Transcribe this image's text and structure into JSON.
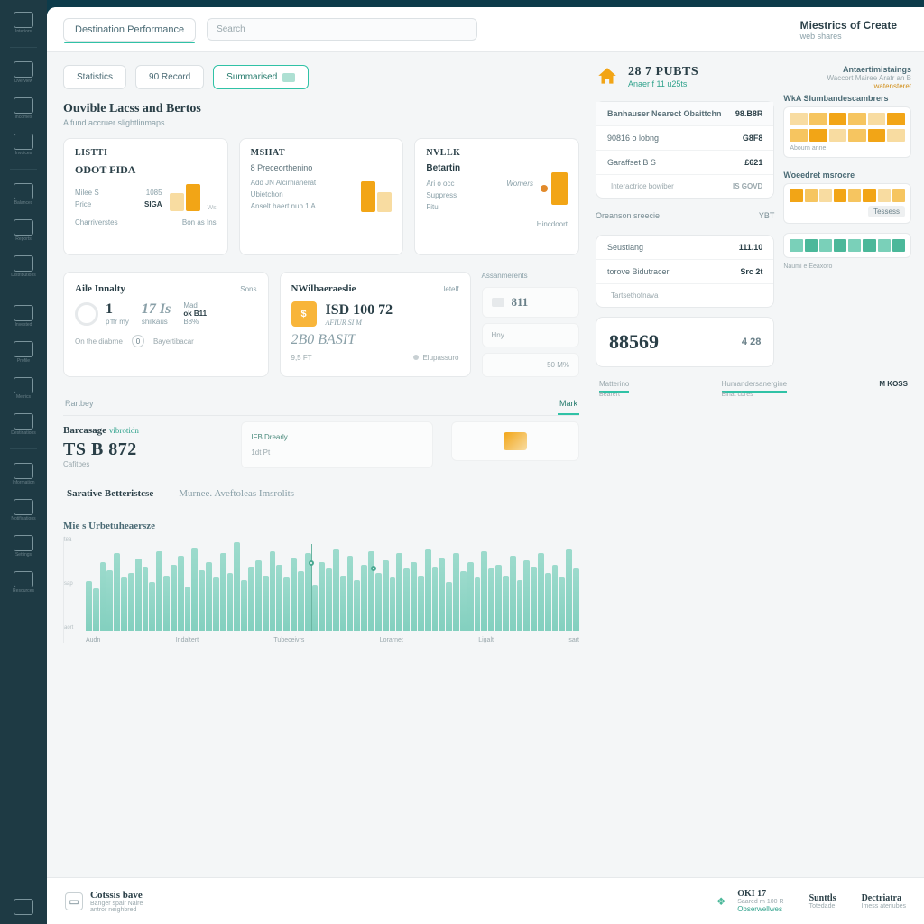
{
  "sidebar": {
    "items": [
      {
        "label": "Interiors"
      },
      {
        "label": "Overview"
      },
      {
        "label": "Incomes"
      },
      {
        "label": "Invoices"
      },
      {
        "label": "Balances"
      },
      {
        "label": "Reports"
      },
      {
        "label": "Distributions"
      },
      {
        "label": "Invested"
      },
      {
        "label": "Profile"
      },
      {
        "label": "Metrics"
      },
      {
        "label": "Destinations"
      },
      {
        "label": "Information"
      },
      {
        "label": "Notifications"
      },
      {
        "label": "Settings"
      },
      {
        "label": "Resources"
      }
    ]
  },
  "topbar": {
    "breadcrumb": "Destination Performance",
    "search_placeholder": "Search",
    "title": "Miestrics of Create",
    "subtitle": "web shares"
  },
  "pills": {
    "a": "Statistics",
    "b": "90 Record",
    "c": "Summarised"
  },
  "section1": {
    "title": "Ouvible Lacss and Bertos",
    "subtitle": "A fund accruer slightlinmaps"
  },
  "cards": [
    {
      "label": "LISTTI",
      "big": "ODOT FIDA",
      "lines": [
        [
          "Milee S",
          "1085"
        ],
        [
          "Price",
          "SIGA"
        ]
      ],
      "foot_l": "Charriverstes",
      "foot_r": "Bon  as Ins",
      "side": "Ws"
    },
    {
      "label": "MSHAT",
      "big": "8 Preceorthenino",
      "lines": [
        [
          "Add JN Alcirhianerat",
          ""
        ],
        [
          "Ubietchon",
          ""
        ],
        [
          "Anselt haert nup 1 A",
          ""
        ]
      ],
      "foot_l": "",
      "foot_r": ""
    },
    {
      "label": "NVLLK",
      "big": "Betartin",
      "lines": [
        [
          "Ari o occ",
          "Womers"
        ],
        [
          "Suppress",
          ""
        ],
        [
          "Fitu",
          ""
        ]
      ],
      "foot_l": "",
      "foot_r": "Hincdoort",
      "badge": ""
    }
  ],
  "wide": {
    "left": {
      "title": "Aile Innalty",
      "side": "Sons",
      "kpi1_val": "1",
      "kpi1_sub1": "p'ffr",
      "kpi1_sub2": "my",
      "kpi2_val": "17 Is",
      "kpi2_sub": "shilkaus",
      "kpi3_lbl": "Mad",
      "kpi3_val": "ok B11",
      "foot_l": "On the diabrne",
      "foot_badge": "0",
      "foot_r": "Bayertibacar",
      "side2": "B8%"
    },
    "mid": {
      "title": "NWilhaeraeslie",
      "side": "letelf",
      "currency_line": "ISD 100 72",
      "sub1": "AFIUR  SI M",
      "big2": "2B0 BASIT",
      "foot1": "9,5 FT",
      "foot2": "Elupassuro"
    },
    "right": {
      "title": "Assanmerents",
      "val": "811",
      "rows": [
        [
          "Hny",
          ""
        ],
        [
          "",
          "50 M%"
        ]
      ]
    }
  },
  "tabs": {
    "items": [
      "Rartbey",
      "Mark"
    ],
    "active": 1
  },
  "sublinks": {
    "a": "IFB Drearly",
    "b": "1dt Pt"
  },
  "balance": {
    "label": "Barcasage",
    "tag": "vibrotidn",
    "value": "TS B 872",
    "hint": "Cafitbes"
  },
  "tab_buttons": {
    "a": "Sarative Betteristcse",
    "b": "Murnee. Aveftoleas Imsrolits"
  },
  "chart": {
    "title": "Mie s Urbetuheaersze",
    "y": [
      "tea",
      "sap",
      "aort"
    ],
    "x": [
      "Audn",
      "Indaltert",
      "Tubeceivrs",
      "Lorarnet",
      "Ligalt",
      "sart"
    ]
  },
  "chart_data": {
    "type": "area",
    "title": "Mie s Urbetuheaersze",
    "x_labels": [
      "Audn",
      "Indaltert",
      "Tubeceivrs",
      "Lorarnet",
      "Ligalt",
      "sart"
    ],
    "y_ticks": [
      "tea",
      "sap",
      "aort"
    ],
    "ylim": [
      0,
      100
    ],
    "values": [
      45,
      38,
      62,
      55,
      70,
      48,
      52,
      65,
      58,
      44,
      72,
      50,
      60,
      68,
      40,
      75,
      55,
      62,
      48,
      70,
      52,
      80,
      46,
      58,
      64,
      50,
      72,
      60,
      48,
      66,
      54,
      70,
      42,
      62,
      56,
      74,
      50,
      68,
      46,
      60,
      72,
      52,
      64,
      48,
      70,
      56,
      62,
      50,
      74,
      58,
      66,
      44,
      70,
      54,
      62,
      48,
      72,
      56,
      60,
      50,
      68,
      46,
      64,
      58,
      70,
      52,
      60,
      48,
      74,
      56
    ],
    "markers": [
      {
        "x_pct": 48
      },
      {
        "x_pct": 60
      }
    ]
  },
  "footer": {
    "items": [
      {
        "icon": "card",
        "label": "Cotssis bave",
        "sub": "Banger spair Naire",
        "sub2": "antror neighbred"
      },
      {
        "icon": "leaf",
        "val": "OKI 17",
        "sub": "Saared rn 100 R",
        "link": "Obserwellwes"
      },
      {
        "icon": "",
        "val": "Sunttls",
        "sub": "Totedade",
        "link": ""
      },
      {
        "icon": "",
        "val": "Dectriatra",
        "sub": "Imess ateriubes",
        "link": ""
      }
    ]
  },
  "right": {
    "title": "28 7 PUBTS",
    "subtitle": "Anaer f  11 u25ts",
    "side_label": "Antaertimistaings",
    "side_sub": "Waccort Mairee Aratr an B",
    "side_amber": "watensteret",
    "list1": [
      {
        "k": "Banhauser Nearect Obaittchn",
        "v": "98.B8R",
        "head": true
      },
      {
        "k": "90816 o lobng",
        "v": "G8F8"
      },
      {
        "k": "Garaffset B S",
        "v": "£621"
      },
      {
        "k": "Interactrice  bowiber",
        "v": "IS GOVD",
        "sub": true
      }
    ],
    "section2_label": "Oreanson sreecie",
    "section2_side": "YBT",
    "list2": [
      {
        "k": "Seustiang",
        "v": "111.10"
      },
      {
        "k": "torove Bidutracer",
        "v": "Src 2t"
      },
      {
        "k": "Tartsethofnava",
        "v": ""
      }
    ],
    "big_val": "88569",
    "big_side": "4 28",
    "sw1_label": "WkA Slumbandescambrers",
    "sw1_foot": "Abourn anne",
    "sw2_label": "Woeedret msrocre",
    "sw2_mid": "Tessess",
    "sw2_foot": "Naumi e Eeaxoro",
    "subtab_a": "Matterino",
    "subtab_b": "Humandersanergine",
    "subtab_c": "M KOSS",
    "subtab_a_sub": "Bearert",
    "subtab_b_sub": "Binat cbres"
  }
}
